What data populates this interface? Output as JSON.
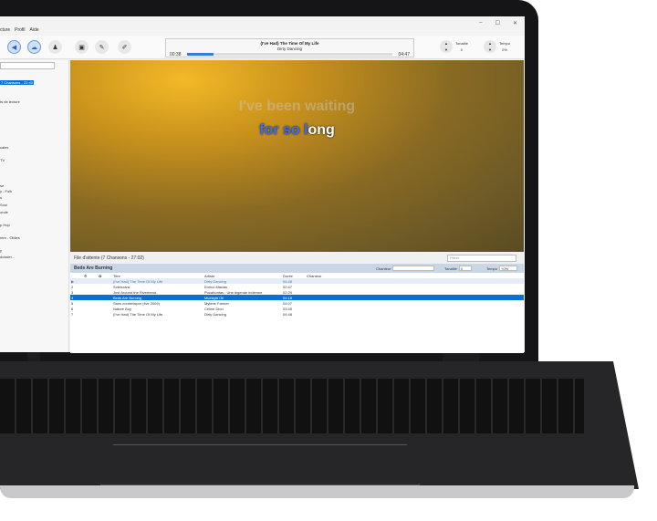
{
  "menu": [
    "cture",
    "Profil",
    "Aide"
  ],
  "window_controls": [
    "–",
    "☐",
    "✕"
  ],
  "toolbar": {
    "buttons": [
      "volume-icon",
      "karaoke-icon",
      "singer-icon",
      "window-icon",
      "wrench-icon",
      "tools-icon"
    ]
  },
  "now_playing": {
    "title": "(I've Had) The Time Of My Life",
    "artist": "Dirty Dancing",
    "current": "00:38",
    "total": "04:47",
    "progress": 0.13
  },
  "tonalite": {
    "label": "Tonalité",
    "value": "0"
  },
  "tempo": {
    "label": "Tempo",
    "value": "0%"
  },
  "sidebar": {
    "items": [
      {
        "label": "7 Chansons - 22:40",
        "selected": true
      },
      {
        "label": "ts de lecture"
      },
      {
        "label": "cales"
      },
      {
        "label": "TV"
      },
      {
        "label": "se"
      },
      {
        "label": "y - Folk"
      },
      {
        "label": "s"
      },
      {
        "label": "Soul"
      },
      {
        "label": "onde"
      },
      {
        "label": "p Hop"
      },
      {
        "label": "ntro - Oldies"
      },
      {
        "label": "y"
      },
      {
        "label": "dossier..."
      }
    ]
  },
  "lyrics": {
    "line1": "I've been waiting",
    "line2_sung": "for so l",
    "line2_rest": "ong"
  },
  "queue": {
    "header": "File d'attente (7 Chansons - 27:02)",
    "filter_placeholder": "Filtrer",
    "current_title": "Beds Are Burning",
    "chanteur_label": "Chanteur",
    "tonalite_label": "Tonalité",
    "tonalite_value": "0",
    "tempo_label": "Tempo",
    "tempo_value": "+0%",
    "columns": [
      "",
      "",
      "",
      "Titre",
      "Artiste",
      "Durée",
      "Chanteur"
    ],
    "rows": [
      {
        "n": "▶",
        "title": "(I've Had) The Time Of My Life",
        "artist": "Dirty Dancing",
        "dur": "04:48",
        "state": "play"
      },
      {
        "n": "2",
        "title": "Solenzara",
        "artist": "Enrico Macias",
        "dur": "02:47"
      },
      {
        "n": "3",
        "title": "Just Around the Riverbend",
        "artist": "Pocahontas : Une légende indienne",
        "dur": "02:29"
      },
      {
        "n": "4",
        "title": "Beds Are Burning",
        "artist": "Midnight Oil",
        "dur": "04:18",
        "state": "sel"
      },
      {
        "n": "5",
        "title": "Sans contrefaçon (live 2009)",
        "artist": "Mylène Farmer",
        "dur": "04:07"
      },
      {
        "n": "6",
        "title": "Nature Boy",
        "artist": "Céline Dion",
        "dur": "03:45"
      },
      {
        "n": "7",
        "title": "(I've Had) The Time Of My Life",
        "artist": "Dirty Dancing",
        "dur": "04:48"
      }
    ]
  }
}
